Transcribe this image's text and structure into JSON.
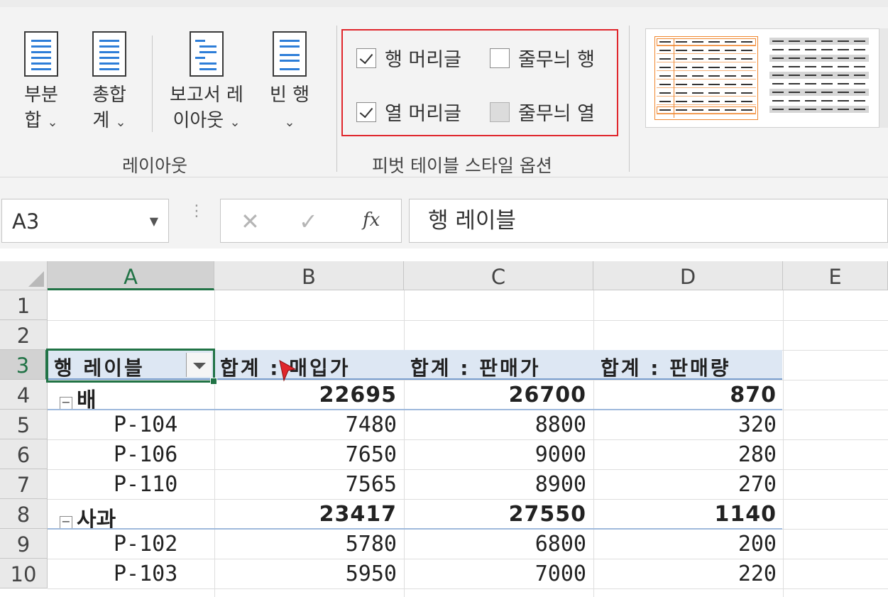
{
  "ribbon": {
    "layout_group": {
      "label": "레이아웃",
      "buttons": [
        {
          "line1": "부분",
          "line2": "합"
        },
        {
          "line1": "총합",
          "line2": "계"
        },
        {
          "line1": "보고서 레",
          "line2": "이아웃"
        },
        {
          "line1": "빈 행",
          "line2": ""
        }
      ]
    },
    "style_options_group": {
      "label": "피벗 테이블 스타일 옵션",
      "checkboxes": [
        {
          "label": "행 머리글",
          "checked": true
        },
        {
          "label": "줄무늬 행",
          "checked": false
        },
        {
          "label": "열 머리글",
          "checked": true
        },
        {
          "label": "줄무늬 열",
          "checked": false
        }
      ],
      "highlight_color": "#e0262c"
    },
    "styles_gallery": {
      "accent_color": "#f0872f"
    }
  },
  "formula_bar": {
    "name_box": "A3",
    "cancel_icon": "close-icon",
    "enter_icon": "check-icon",
    "fx_label": "fx",
    "formula": "행 레이블"
  },
  "grid": {
    "columns": [
      "A",
      "B",
      "C",
      "D",
      "E"
    ],
    "selected_column": "A",
    "rows": [
      "1",
      "2",
      "3",
      "4",
      "5",
      "6",
      "7",
      "8",
      "9",
      "10"
    ],
    "selected_row": "3",
    "pivot": {
      "headers": [
        "행 레이블",
        "합계 : 매입가",
        "합계 : 판매가",
        "합계 : 판매량"
      ],
      "body": [
        {
          "label": "배",
          "values": [
            "22695",
            "26700",
            "870"
          ],
          "group": true
        },
        {
          "label": "P-104",
          "values": [
            "7480",
            "8800",
            "320"
          ],
          "group": false
        },
        {
          "label": "P-106",
          "values": [
            "7650",
            "9000",
            "280"
          ],
          "group": false
        },
        {
          "label": "P-110",
          "values": [
            "7565",
            "8900",
            "270"
          ],
          "group": false
        },
        {
          "label": "사과",
          "values": [
            "23417",
            "27550",
            "1140"
          ],
          "group": true
        },
        {
          "label": "P-102",
          "values": [
            "5780",
            "6800",
            "200"
          ],
          "group": false
        },
        {
          "label": "P-103",
          "values": [
            "5950",
            "7000",
            "220"
          ],
          "group": false
        }
      ]
    }
  },
  "colors": {
    "excel_green": "#217346",
    "pivot_header_bg": "#dde7f3",
    "cursor": "#e0262c"
  }
}
